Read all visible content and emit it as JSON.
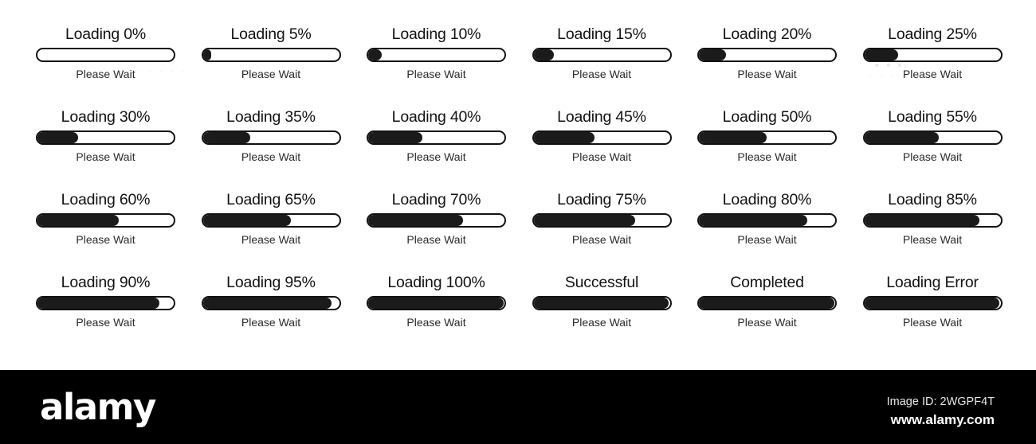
{
  "background_color": "#ffffff",
  "bar": {
    "border_color": "#111111",
    "fill_color": "#1b1b1b",
    "track_color": "#ffffff"
  },
  "loaders": [
    {
      "title": "Loading 0%",
      "percent": 0,
      "subtitle": "Please Wait"
    },
    {
      "title": "Loading 5%",
      "percent": 5,
      "subtitle": "Please Wait"
    },
    {
      "title": "Loading 10%",
      "percent": 10,
      "subtitle": "Please Wait"
    },
    {
      "title": "Loading 15%",
      "percent": 15,
      "subtitle": "Please Wait"
    },
    {
      "title": "Loading 20%",
      "percent": 20,
      "subtitle": "Please Wait"
    },
    {
      "title": "Loading 25%",
      "percent": 25,
      "subtitle": "Please Wait"
    },
    {
      "title": "Loading 30%",
      "percent": 30,
      "subtitle": "Please Wait"
    },
    {
      "title": "Loading 35%",
      "percent": 35,
      "subtitle": "Please Wait"
    },
    {
      "title": "Loading 40%",
      "percent": 40,
      "subtitle": "Please Wait"
    },
    {
      "title": "Loading 45%",
      "percent": 45,
      "subtitle": "Please Wait"
    },
    {
      "title": "Loading 50%",
      "percent": 50,
      "subtitle": "Please Wait"
    },
    {
      "title": "Loading 55%",
      "percent": 55,
      "subtitle": "Please Wait"
    },
    {
      "title": "Loading 60%",
      "percent": 60,
      "subtitle": "Please Wait"
    },
    {
      "title": "Loading 65%",
      "percent": 65,
      "subtitle": "Please Wait"
    },
    {
      "title": "Loading 70%",
      "percent": 70,
      "subtitle": "Please Wait"
    },
    {
      "title": "Loading 75%",
      "percent": 75,
      "subtitle": "Please Wait"
    },
    {
      "title": "Loading 80%",
      "percent": 80,
      "subtitle": "Please Wait"
    },
    {
      "title": "Loading 85%",
      "percent": 85,
      "subtitle": "Please Wait"
    },
    {
      "title": "Loading 90%",
      "percent": 90,
      "subtitle": "Please Wait"
    },
    {
      "title": "Loading 95%",
      "percent": 95,
      "subtitle": "Please Wait"
    },
    {
      "title": "Loading 100%",
      "percent": 100,
      "subtitle": "Please Wait"
    },
    {
      "title": "Successful",
      "percent": 100,
      "subtitle": "Please Wait"
    },
    {
      "title": "Completed",
      "percent": 100,
      "subtitle": "Please Wait"
    },
    {
      "title": "Loading Error",
      "percent": 100,
      "subtitle": "Please Wait"
    }
  ],
  "footer": {
    "logo_text": "alamy",
    "image_id": "Image ID: 2WGPF4T",
    "url": "www.alamy.com",
    "band_color": "#000000",
    "text_color": "#ffffff"
  }
}
